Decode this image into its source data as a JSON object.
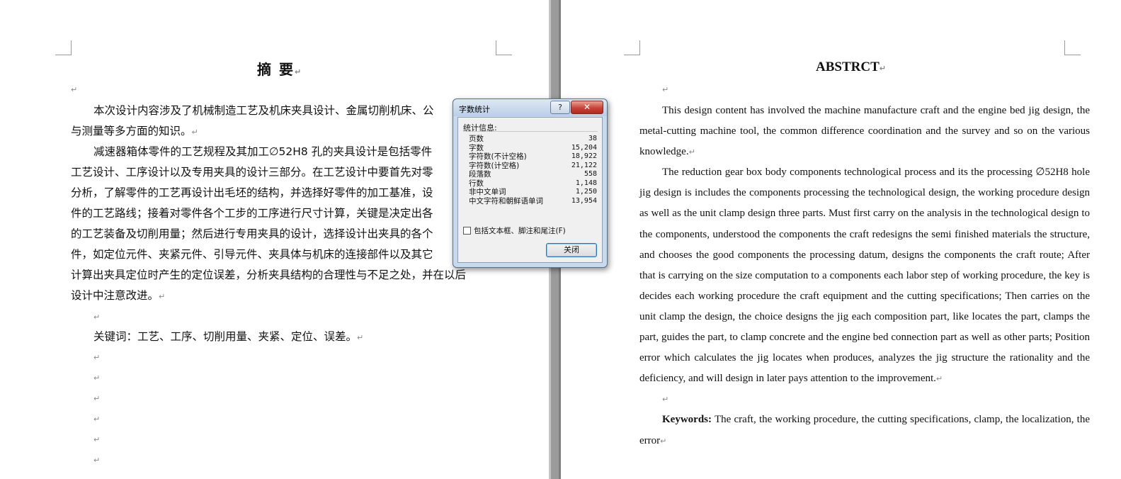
{
  "left_page": {
    "title": "摘  要",
    "lines": [
      {
        "text": "本次设计内容涉及了机械制造工艺及机床夹具设计、金属切削机床、公",
        "indent": true
      },
      {
        "text": "与测量等多方面的知识。",
        "indent": false,
        "mark": true
      },
      {
        "text": "减速器箱体零件的工艺规程及其加工∅52H8 孔的夹具设计是包括零件",
        "indent": true
      },
      {
        "text": "工艺设计、工序设计以及专用夹具的设计三部分。在工艺设计中要首先对零",
        "indent": false
      },
      {
        "text": "分析，了解零件的工艺再设计出毛坯的结构，并选择好零件的加工基准，设",
        "indent": false
      },
      {
        "text": "件的工艺路线；接着对零件各个工步的工序进行尺寸计算，关键是决定出各",
        "indent": false
      },
      {
        "text": "的工艺装备及切削用量；然后进行专用夹具的设计，选择设计出夹具的各个",
        "indent": false
      },
      {
        "text": "件，如定位元件、夹紧元件、引导元件、夹具体与机床的连接部件以及其它",
        "indent": false
      },
      {
        "text": "计算出夹具定位时产生的定位误差，分析夹具结构的合理性与不足之处，并在以后",
        "indent": false
      },
      {
        "text": "设计中注意改进。",
        "indent": false,
        "mark": true
      },
      {
        "text": "",
        "indent": true,
        "mark": true
      },
      {
        "text": "关键词：工艺、工序、切削用量、夹紧、定位、误差。",
        "indent": true,
        "mark": true
      }
    ],
    "empty_marks": 6
  },
  "right_page": {
    "title": "ABSTRCT",
    "paragraphs": [
      "This design content has involved the machine manufacture craft and the engine bed jig design, the metal-cutting machine tool, the common difference coordination and the survey and so on the various knowledge.",
      "The reduction gear box body components technological process and its the processing ∅52H8 hole jig design is includes the components processing the technological design, the working procedure design as well as the unit clamp design three parts. Must first carry on the analysis in the technological design to the components, understood the components the craft redesigns the semi finished materials the structure, and chooses the good components the processing datum, designs the components the craft route; After that is carrying on the size computation to a components each labor step of working procedure, the key is decides each working procedure the craft equipment and the cutting specifications; Then carries on the unit clamp the design, the choice designs the jig each composition part, like locates the part, clamps the part, guides the part, to clamp concrete and the engine bed connection part as well as other parts; Position error which calculates the jig locates when produces, analyzes the jig structure the rationality and the deficiency, and will design in later pays attention to the improvement."
    ],
    "keywords_label": "Keywords:",
    "keywords_text": " The craft, the working procedure, the cutting specifications, clamp, the localization, the error"
  },
  "dialog": {
    "title": "字数统计",
    "help": "?",
    "close_x": "✕",
    "group_label": "统计信息:",
    "stats": [
      {
        "label": "页数",
        "value": "38"
      },
      {
        "label": "字数",
        "value": "15,204"
      },
      {
        "label": "字符数(不计空格)",
        "value": "18,922"
      },
      {
        "label": "字符数(计空格)",
        "value": "21,122"
      },
      {
        "label": "段落数",
        "value": "558"
      },
      {
        "label": "行数",
        "value": "1,148"
      },
      {
        "label": "非中文单词",
        "value": "1,250"
      },
      {
        "label": "中文字符和朝鲜语单词",
        "value": "13,954"
      }
    ],
    "checkbox_label": "包括文本框、脚注和尾注(F)",
    "close_button": "关闭"
  }
}
